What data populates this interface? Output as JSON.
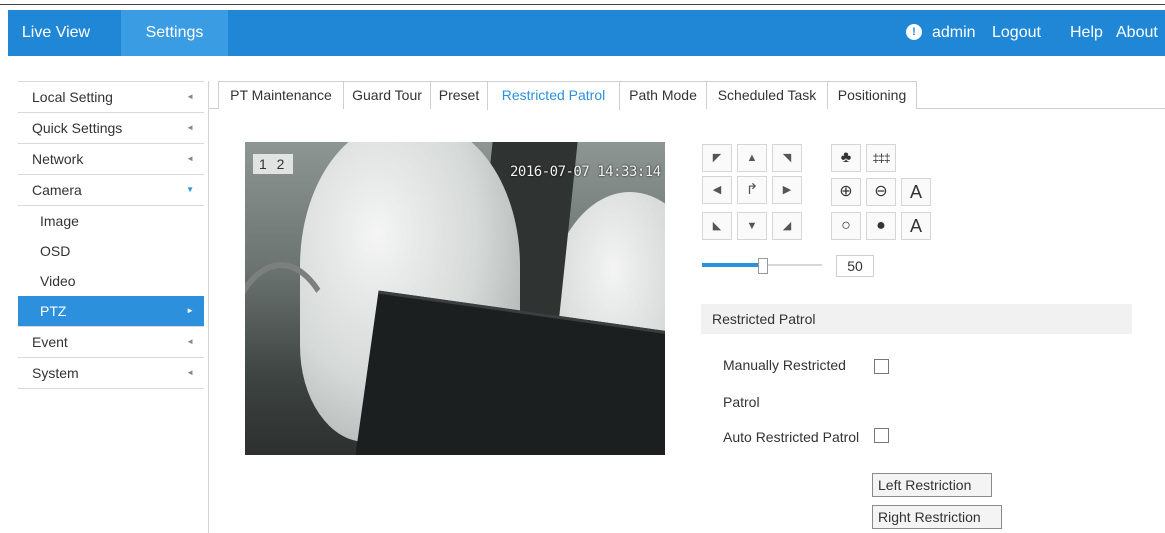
{
  "topbar": {
    "tabs": [
      {
        "label": "Live View"
      },
      {
        "label": "Settings"
      }
    ],
    "user": "admin",
    "links": [
      "Logout",
      "Help",
      "About"
    ]
  },
  "sidebar": {
    "items": [
      {
        "label": "Local Setting",
        "arrow": "◄"
      },
      {
        "label": "Quick Settings",
        "arrow": "◄"
      },
      {
        "label": "Network",
        "arrow": "◄"
      },
      {
        "label": "Camera",
        "arrow": "▼"
      },
      {
        "label": "Image"
      },
      {
        "label": "OSD"
      },
      {
        "label": "Video"
      },
      {
        "label": "PTZ",
        "arrow": "►"
      },
      {
        "label": "Event",
        "arrow": "◄"
      },
      {
        "label": "System",
        "arrow": "◄"
      }
    ]
  },
  "tabs": [
    {
      "label": "PT Maintenance"
    },
    {
      "label": "Guard Tour"
    },
    {
      "label": "Preset"
    },
    {
      "label": "Restricted Patrol"
    },
    {
      "label": "Path Mode"
    },
    {
      "label": "Scheduled Task"
    },
    {
      "label": "Positioning"
    }
  ],
  "video": {
    "channel_label": "1 2",
    "timestamp": "2016-07-07 14:33:14"
  },
  "ptz": {
    "speed_value": "50",
    "speed_fraction": 0.5,
    "zoom_label": "A",
    "focus_label": "A"
  },
  "restricted_patrol": {
    "title": "Restricted Patrol",
    "manual_label_line1": "Manually Restricted",
    "manual_label_line2": "Patrol",
    "auto_label": "Auto Restricted Patrol",
    "left_button": "Left Restriction",
    "right_button": "Right Restriction"
  },
  "colors": {
    "topbar": "#1f87d6",
    "accent": "#2c90dc"
  }
}
